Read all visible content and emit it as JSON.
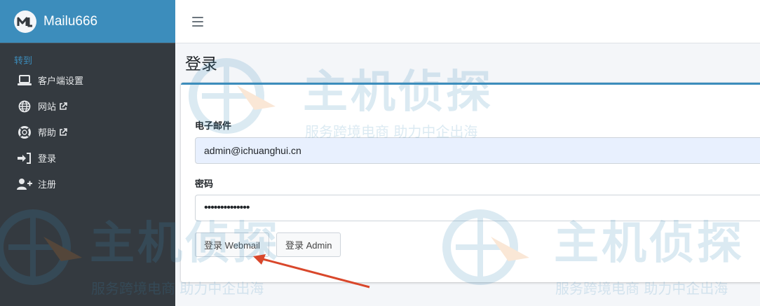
{
  "brand": {
    "name": "Mailu666"
  },
  "sidebar": {
    "header": "转到",
    "items": [
      {
        "label": "客户端设置",
        "icon": "laptop-icon"
      },
      {
        "label": "网站",
        "icon": "globe-icon",
        "external": true
      },
      {
        "label": "帮助",
        "icon": "lifebuoy-icon",
        "external": true
      },
      {
        "label": "登录",
        "icon": "sign-in-icon"
      },
      {
        "label": "注册",
        "icon": "user-plus-icon"
      }
    ]
  },
  "page": {
    "title": "登录"
  },
  "form": {
    "email_label": "电子邮件",
    "email_value": "admin@ichuanghui.cn",
    "password_label": "密码",
    "password_value": "••••••••••••••",
    "webmail_button": "登录 Webmail",
    "admin_button": "登录 Admin"
  },
  "watermark": {
    "main": "主机侦探",
    "sub": "服务跨境电商 助力中企出海"
  },
  "colors": {
    "accent": "#3c8dbc",
    "sidebar": "#343a40",
    "annotation_arrow": "#d9472b"
  }
}
